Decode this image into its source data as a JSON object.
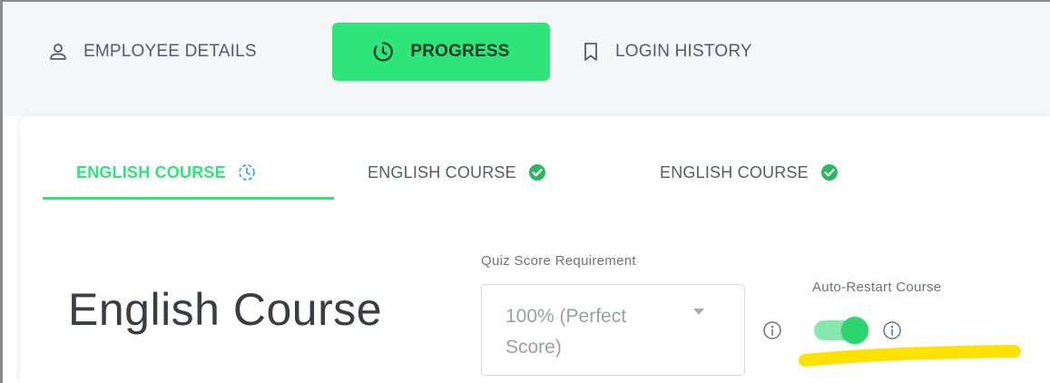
{
  "top_tabs": [
    {
      "label": "EMPLOYEE DETAILS",
      "icon": "user-icon"
    },
    {
      "label": "PROGRESS",
      "icon": "clock-icon",
      "active": true
    },
    {
      "label": "LOGIN HISTORY",
      "icon": "bookmark-icon"
    }
  ],
  "course_tabs": [
    {
      "label": "ENGLISH COURSE",
      "status_icon": "clock-icon",
      "active": true
    },
    {
      "label": "ENGLISH COURSE",
      "status_icon": "check-circle-icon"
    },
    {
      "label": "ENGLISH COURSE",
      "status_icon": "check-circle-icon"
    }
  ],
  "course": {
    "title": "English Course",
    "quiz_score": {
      "label": "Quiz Score Requirement",
      "value_line1": "100% (Perfect",
      "value_line2": "Score)"
    },
    "auto_restart": {
      "label": "Auto-Restart Course",
      "enabled": true
    }
  },
  "colors": {
    "accent": "#2ee57a",
    "topbar_bg": "#f5f6f8",
    "text": "#555c66",
    "title": "#3a3d44",
    "highlight": "#ffe100"
  }
}
